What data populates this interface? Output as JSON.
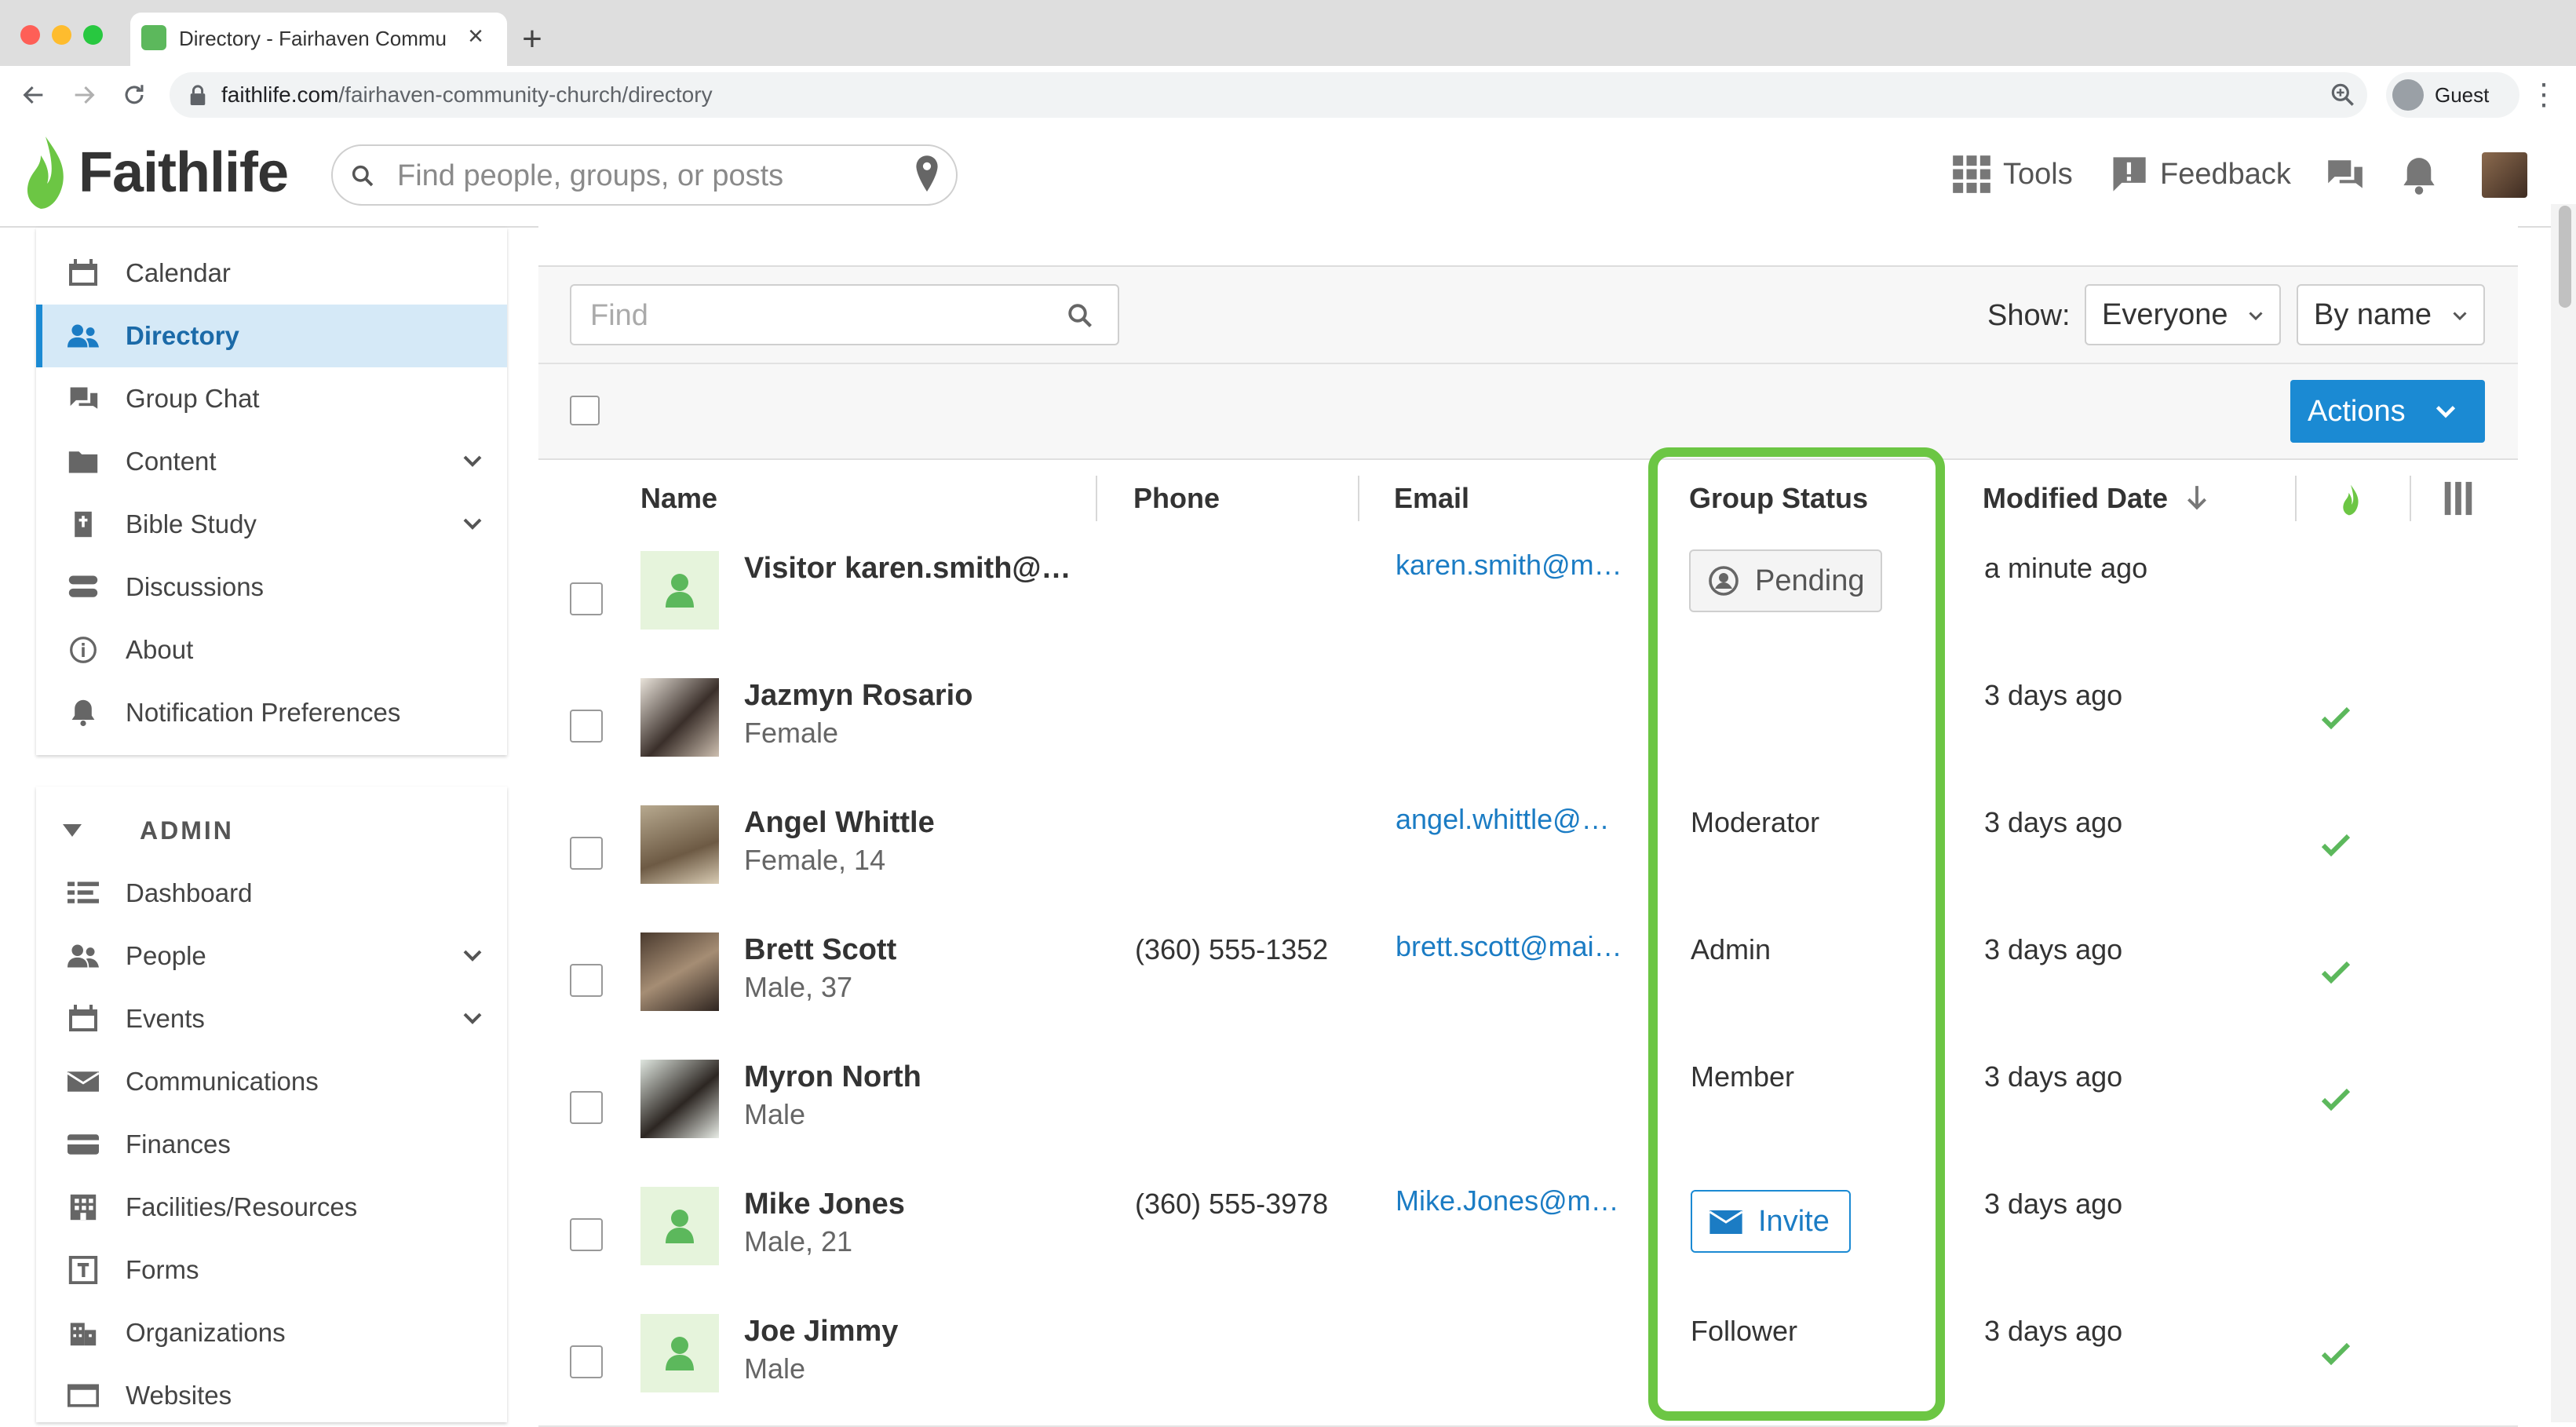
{
  "browser": {
    "tab_title": "Directory - Fairhaven Community Church",
    "url_host": "faithlife.com",
    "url_path": "/fairhaven-community-church/directory",
    "profile_label": "Guest",
    "icons": [
      "back-icon",
      "forward-icon",
      "reload-icon",
      "lock-icon",
      "zoom-icon",
      "profile-icon",
      "kebab-menu-icon"
    ]
  },
  "header": {
    "logo_text": "Faithlife",
    "search_placeholder": "Find people, groups, or posts",
    "tools_label": "Tools",
    "feedback_label": "Feedback",
    "brand_color": "#6cc644"
  },
  "sidebar": {
    "items": [
      {
        "label": "Calendar",
        "icon": "calendar-icon"
      },
      {
        "label": "Directory",
        "icon": "people-icon",
        "active": true
      },
      {
        "label": "Group Chat",
        "icon": "chat-icon"
      },
      {
        "label": "Content",
        "icon": "folder-icon",
        "expandable": true
      },
      {
        "label": "Bible Study",
        "icon": "bible-icon",
        "expandable": true
      },
      {
        "label": "Discussions",
        "icon": "discussions-icon"
      },
      {
        "label": "About",
        "icon": "info-icon"
      },
      {
        "label": "Notification Preferences",
        "icon": "bell-icon"
      }
    ],
    "admin_label": "ADMIN",
    "admin_items": [
      {
        "label": "Dashboard",
        "icon": "dashboard-icon"
      },
      {
        "label": "People",
        "icon": "people-icon",
        "expandable": true
      },
      {
        "label": "Events",
        "icon": "calendar-icon",
        "expandable": true
      },
      {
        "label": "Communications",
        "icon": "envelope-icon"
      },
      {
        "label": "Finances",
        "icon": "credit-card-icon"
      },
      {
        "label": "Facilities/Resources",
        "icon": "building-icon"
      },
      {
        "label": "Forms",
        "icon": "form-icon"
      },
      {
        "label": "Organizations",
        "icon": "organization-icon"
      },
      {
        "label": "Websites",
        "icon": "website-icon"
      }
    ]
  },
  "filters": {
    "find_placeholder": "Find",
    "show_label": "Show:",
    "show_value": "Everyone",
    "sort_value": "By name",
    "actions_label": "Actions"
  },
  "table": {
    "columns": {
      "name": "Name",
      "phone": "Phone",
      "email": "Email",
      "group_status": "Group Status",
      "modified": "Modified Date"
    },
    "rows": [
      {
        "name": "Visitor karen.smith@m…",
        "sub": "",
        "phone": "",
        "email": "karen.smith@m…",
        "status": "Pending",
        "status_kind": "pending",
        "modified": "a minute ago",
        "faithlife": false,
        "photo": "placeholder"
      },
      {
        "name": "Jazmyn Rosario",
        "sub": "Female",
        "phone": "",
        "email": "",
        "status": "",
        "status_kind": "none",
        "modified": "3 days ago",
        "faithlife": true,
        "photo": "photo"
      },
      {
        "name": "Angel Whittle",
        "sub": "Female, 14",
        "phone": "",
        "email": "angel.whittle@…",
        "status": "Moderator",
        "status_kind": "text",
        "modified": "3 days ago",
        "faithlife": true,
        "photo": "photo"
      },
      {
        "name": "Brett Scott",
        "sub": "Male, 37",
        "phone": "(360) 555-1352",
        "email": "brett.scott@mai…",
        "status": "Admin",
        "status_kind": "text",
        "modified": "3 days ago",
        "faithlife": true,
        "photo": "photo"
      },
      {
        "name": "Myron North",
        "sub": "Male",
        "phone": "",
        "email": "",
        "status": "Member",
        "status_kind": "text",
        "modified": "3 days ago",
        "faithlife": true,
        "photo": "photo"
      },
      {
        "name": "Mike Jones",
        "sub": "Male, 21",
        "phone": "(360) 555-3978",
        "email": "Mike.Jones@m…",
        "status": "Invite",
        "status_kind": "invite",
        "modified": "3 days ago",
        "faithlife": false,
        "photo": "placeholder"
      },
      {
        "name": "Joe Jimmy",
        "sub": "Male",
        "phone": "",
        "email": "",
        "status": "Follower",
        "status_kind": "text",
        "modified": "3 days ago",
        "faithlife": true,
        "photo": "placeholder"
      }
    ]
  },
  "colors": {
    "accent_blue": "#1b8ad3",
    "highlight_green": "#6cc644",
    "check_green": "#5cb85c"
  }
}
